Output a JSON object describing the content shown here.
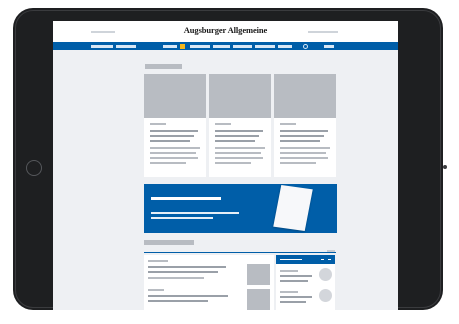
{
  "masthead": {
    "title": "Augsburger Allgemeine"
  },
  "icons": [
    "home-button-icon",
    "camera-icon",
    "search-icon",
    "user-icon"
  ],
  "colors": {
    "brand_blue": "#005ea8",
    "badge_yellow": "#f3b71c",
    "placeholder_grey": "#b8bcc2",
    "page_bg": "#eef0f3"
  }
}
